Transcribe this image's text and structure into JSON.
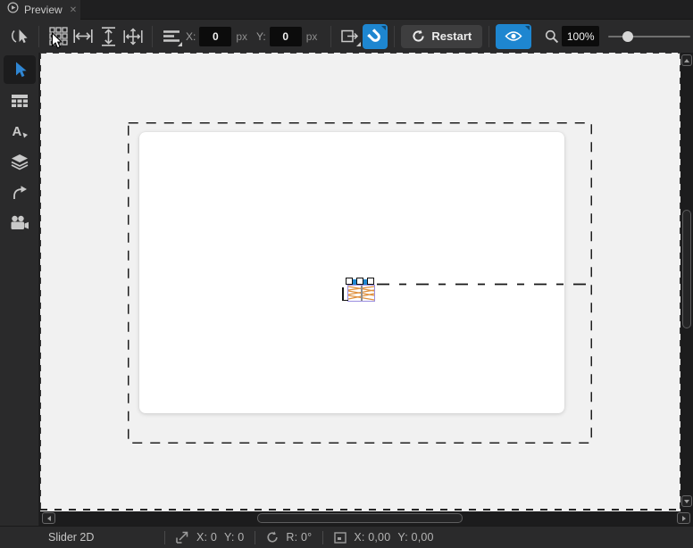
{
  "tab_bar": {
    "tabs": [
      {
        "title": "Preview",
        "close_glyph": "✕"
      }
    ]
  },
  "toolbar": {
    "position_fields": {
      "x_label": "X:",
      "x_value": "0",
      "x_unit": "px",
      "y_label": "Y:",
      "y_value": "0",
      "y_unit": "px"
    },
    "restart_button": {
      "label": "Restart"
    },
    "zoom": {
      "level": "100%"
    },
    "icons": [
      "pick-cursor",
      "grid",
      "fit-width",
      "fit-height",
      "fit-all",
      "align-list",
      "layout-parent",
      "snap-magnet",
      "restart-refresh",
      "visibility-eye",
      "zoom-magnifier"
    ]
  },
  "sidebar": {
    "tools": [
      "select-tool",
      "table-view",
      "text-tool",
      "layers",
      "connections",
      "camera"
    ],
    "text_tool_glyph": "A"
  },
  "status_bar": {
    "item_name": "Slider 2D",
    "position": {
      "x": "X: 0",
      "y": "Y: 0"
    },
    "rotation": "R: 0°",
    "size": {
      "x": "X: 0,00",
      "y": "Y: 0,00"
    }
  },
  "colors": {
    "accent_blue": "#1e86d0",
    "canvas_bg": "#f1f1f1",
    "selection_purple": "#9b8fe0",
    "hatch_orange": "#e0913f"
  }
}
